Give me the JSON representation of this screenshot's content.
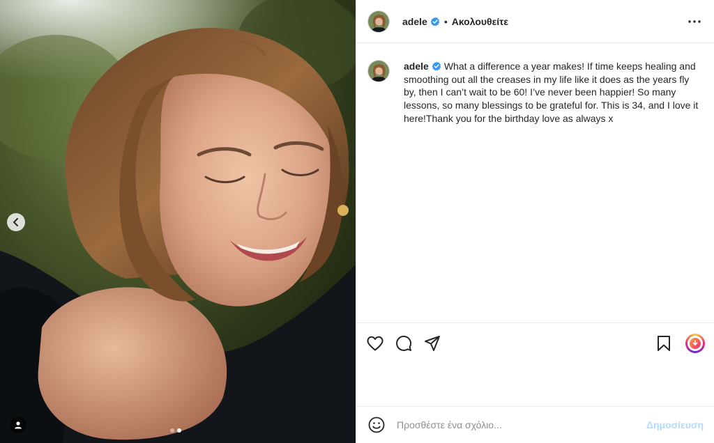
{
  "post": {
    "username": "adele",
    "separator": "•",
    "follow_status": "Ακολουθείτε",
    "caption_username": "adele",
    "caption": "What a difference a year makes! If time keeps healing and smoothing out all the creases in my life like it does as the years fly by, then I can’t wait to be 60! I’ve never been happier! So many lessons, so many blessings to be grateful for. This is 34, and I love it here!Thank you for the birthday love as always x"
  },
  "comment_box": {
    "placeholder": "Προσθέστε ένα σχόλιο...",
    "post_label": "Δημοσίευση"
  },
  "carousel": {
    "total_slides": 2,
    "active_slide": 2
  },
  "icons": {
    "verified": "verified-badge-icon",
    "more": "more-options-icon",
    "like": "heart-icon",
    "comment": "comment-icon",
    "share": "share-icon",
    "save": "bookmark-icon",
    "emoji": "emoji-icon",
    "prev": "chevron-left-icon",
    "tag": "user-tag-icon"
  },
  "colors": {
    "verified_blue": "#3897f0",
    "post_button_disabled": "#b3dbff",
    "text": "#262626",
    "muted": "#8e8e8e",
    "divider": "#efefef"
  }
}
